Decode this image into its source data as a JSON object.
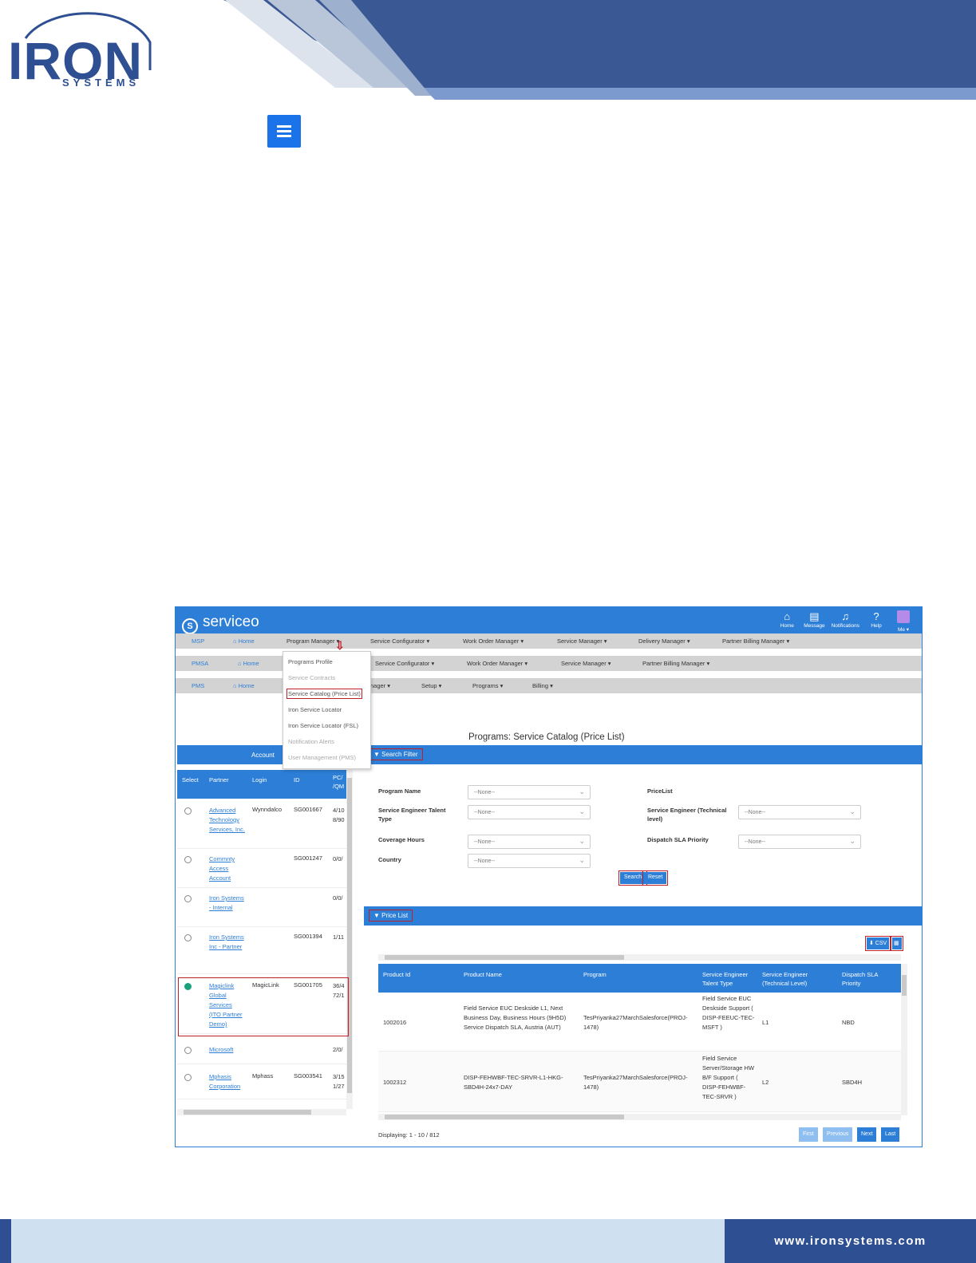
{
  "brand": {
    "logo_word": "IRON",
    "logo_sub": "SYSTEMS",
    "footer_url": "www.ironsystems.com",
    "primary_color": "#2e4f91",
    "app_accent": "#2d7ed6"
  },
  "app": {
    "name": "serviceo",
    "top_icons": [
      {
        "icon": "home-icon",
        "label": "Home"
      },
      {
        "icon": "message-icon",
        "label": "Message"
      },
      {
        "icon": "bell-icon",
        "label": "Notifications"
      },
      {
        "icon": "help-icon",
        "label": "Help"
      },
      {
        "icon": "avatar",
        "label": "Me"
      }
    ],
    "nav_rows": [
      {
        "badge": "MSP",
        "home": "Home",
        "items": [
          "Program Manager ▾",
          "Service Configurator ▾",
          "Work Order Manager ▾",
          "Service Manager ▾",
          "Delivery Manager ▾",
          "Partner Billing Manager ▾"
        ]
      },
      {
        "badge": "PMSA",
        "home": "Home",
        "items": [
          "Service Configurator ▾",
          "Work Order Manager ▾",
          "Service Manager ▾",
          "Partner Billing Manager ▾"
        ]
      },
      {
        "badge": "PMS",
        "home": "Home",
        "items": [
          "nager ▾",
          "Setup ▾",
          "Programs ▾",
          "Billing ▾"
        ]
      }
    ],
    "dropdown": [
      "Programs Profile",
      "Service Contracts",
      "Service Catalog (Price List)",
      "Iron Service Locator",
      "Iron Service Locator (FSL)",
      "Notification Alerts",
      "User Management (PMS)"
    ],
    "page_title": "Programs: Service Catalog (Price List)",
    "account_panel": {
      "header": "Account",
      "columns": [
        "Select",
        "Partner",
        "Login",
        "ID",
        "PC/\n/QM"
      ],
      "rows": [
        {
          "partner": "Advanced Technology Services, Inc.",
          "login": "Wynndalco",
          "id": "SG001667",
          "po": "4/10 8/90",
          "selected": false
        },
        {
          "partner": "Commnty Access Account",
          "login": "",
          "id": "SG001247",
          "po": "0/0/",
          "selected": false
        },
        {
          "partner": "Iron Systems - Internal",
          "login": "",
          "id": "",
          "po": "0/0/",
          "selected": false
        },
        {
          "partner": "Iron Systems Inc - Partner",
          "login": "",
          "id": "SG001394",
          "po": "1/11",
          "selected": false
        },
        {
          "partner": "Magiclink Global Services (ITO Partner Demo)",
          "login": "MagicLink",
          "id": "SG001705",
          "po": "36/4 72/1",
          "selected": true
        },
        {
          "partner": "Microsoft",
          "login": "",
          "id": "",
          "po": "2/0/",
          "selected": false
        },
        {
          "partner": "Mphasis Corporation",
          "login": "Mphass",
          "id": "SG003541",
          "po": "3/15 1/27",
          "selected": false
        }
      ]
    },
    "search_filter": {
      "title": "Search Filter",
      "labels": {
        "program_name": "Program Name",
        "talent_type": "Service Engineer Talent Type",
        "coverage": "Coverage Hours",
        "country": "Country",
        "pricelist": "PriceList",
        "technical_level": "Service Engineer (Technical level)",
        "dispatch_sla": "Dispatch SLA Priority"
      },
      "none_option": "--None--",
      "search_label": "Search",
      "reset_label": "Reset"
    },
    "price_list": {
      "title": "Price List",
      "csv_label": "⬇ CSV",
      "columns": [
        "Product Id",
        "Product Name",
        "Program",
        "Service Engineer Talent Type",
        "Service Engineer (Technical Level)",
        "Dispatch SLA Priority"
      ],
      "rows": [
        {
          "id": "1002016",
          "name": "Field Service EUC Deskside L1, Next Business Day, Business Hours (9H5D) Service Dispatch SLA, Austria (AUT)",
          "program": "TesPriyanka27MarchSalesforce(PROJ-1478)",
          "talent": "Field Service EUC Deskside Support ( DISP-FEEUC-TEC-MSFT )",
          "level": "L1",
          "sla": "NBD"
        },
        {
          "id": "1002312",
          "name": "DISP-FEHWBF-TEC-SRVR-L1-HKG-SBD4H-24x7-DAY",
          "program": "TesPriyanka27MarchSalesforce(PROJ-1478)",
          "talent": "Field Service Server/Storage HW B/F Support ( DISP-FEHWBF-TEC-SRVR )",
          "level": "L2",
          "sla": "SBD4H"
        }
      ],
      "displaying": "Displaying: 1 - 10 / 812",
      "pager": [
        "First",
        "Previous",
        "Next",
        "Last"
      ]
    }
  }
}
